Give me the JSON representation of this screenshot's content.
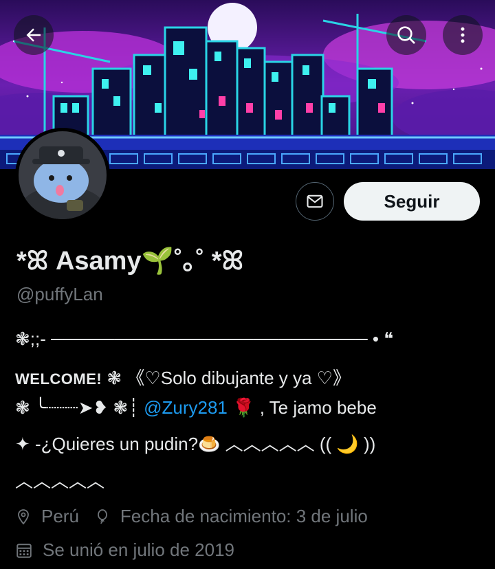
{
  "profile": {
    "display_name_prefix": "*ꕤ",
    "display_name": "Asamy",
    "display_name_suffix_sprout": "🌱",
    "display_name_suffix": "˚｡˚ *ꕤ",
    "handle": "@puffyLan",
    "follow_label": "Seguir"
  },
  "bio": {
    "line1": "❃;;- ───────────────────────── •      ❝",
    "line2_welcome": "WELCOME!",
    "line2_rest": "    ❃ 《♡Solo dibujante y ya ♡》",
    "line3_start": "❃       ╰┈┈┈➤❥ ❃┊",
    "line3_mention": "@Zury281",
    "line3_rose": " 🌹",
    "line3_end": " , Te jamo bebe",
    "line4": "✦  -¿Quieres un pudin?🍮  ︿︿︿︿︿ (( 🌙 ))",
    "line5": "︿︿︿︿︿"
  },
  "meta": {
    "location": "Perú",
    "birthday": "Fecha de nacimiento: 3 de julio",
    "joined": "Se unió en julio de 2019"
  },
  "icons": {
    "back": "back-arrow-icon",
    "search": "search-icon",
    "more": "more-vertical-icon",
    "mail": "mail-icon",
    "location": "location-pin-icon",
    "birthday": "balloon-icon",
    "calendar": "calendar-icon"
  },
  "colors": {
    "background": "#000000",
    "text": "#e7e9ea",
    "secondary": "#71767b",
    "accent": "#1d9bf0",
    "button_bg": "#eff3f4"
  }
}
